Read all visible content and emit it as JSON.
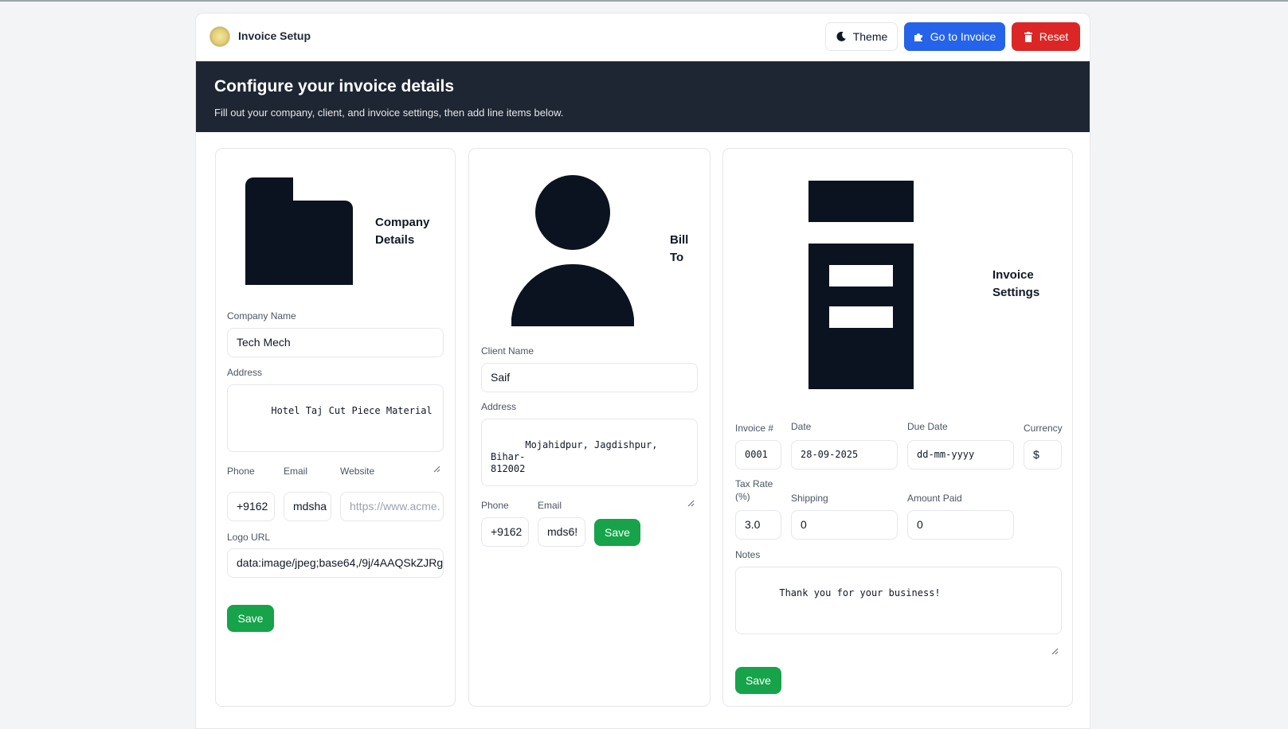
{
  "header": {
    "app_title": "Invoice Setup",
    "theme_label": "Theme",
    "go_label": "Go to Invoice",
    "reset_label": "Reset"
  },
  "banner": {
    "title": "Configure your invoice details",
    "subtitle": "Fill out your company, client, and invoice settings, then add line items below."
  },
  "company": {
    "heading_line1": "Company",
    "heading_line2": "Details",
    "name_label": "Company Name",
    "name_value": "Tech Mech",
    "address_label": "Address",
    "address_value": "Hotel Taj Cut Piece Material",
    "phone_label": "Phone",
    "phone_value": "+9162",
    "email_label": "Email",
    "email_value": "mdsha",
    "website_label": "Website",
    "website_placeholder": "https://www.acme.",
    "logo_label": "Logo URL",
    "logo_value": "data:image/jpeg;base64,/9j/4AAQSkZJRgA",
    "save_label": "Save"
  },
  "client": {
    "heading_line1": "Bill",
    "heading_line2": "To",
    "name_label": "Client Name",
    "name_value": "Saif",
    "address_label": "Address",
    "address_value": "Mojahidpur, Jagdishpur, Bihar-\n812002",
    "phone_label": "Phone",
    "phone_value": "+9162",
    "email_label": "Email",
    "email_value": "mds6!",
    "save_label": "Save"
  },
  "settings": {
    "heading_line1": "Invoice",
    "heading_line2": "Settings",
    "invoice_no_label": "Invoice #",
    "invoice_no_value": "0001",
    "date_label": "Date",
    "date_value": "28-09-2025",
    "due_label": "Due Date",
    "due_value": "dd-mm-yyyy",
    "currency_label": "Currency",
    "currency_value": "$",
    "tax_label_line1": "Tax Rate",
    "tax_label_line2": "(%)",
    "tax_value": "3.0",
    "shipping_label": "Shipping",
    "shipping_value": "0",
    "paid_label": "Amount Paid",
    "paid_value": "0",
    "notes_label": "Notes",
    "notes_value": "Thank you for your business!",
    "save_label": "Save"
  },
  "icons": [
    "moon-icon",
    "puzzle-icon",
    "trash-icon",
    "folder-icon",
    "user-icon",
    "document-icon"
  ],
  "colors": {
    "primary": "#2563eb",
    "danger": "#dc2626",
    "success": "#16a34a",
    "banner": "#1e2633",
    "icon": "#0b1220"
  }
}
